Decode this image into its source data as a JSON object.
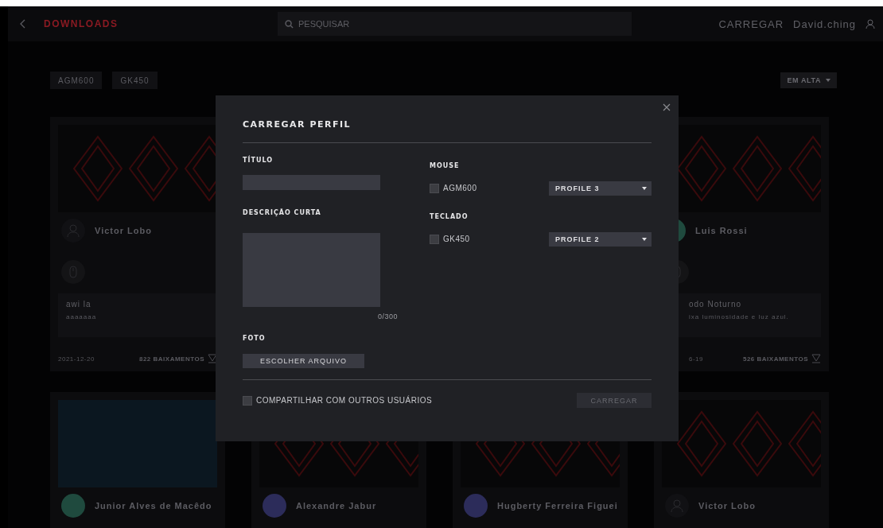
{
  "topbar": {
    "title": "DOWNLOADS",
    "search": {
      "placeholder": "PESQUISAR"
    },
    "upload_link": "CARREGAR",
    "user": "David.ching"
  },
  "filters": [
    {
      "label": "AGM600"
    },
    {
      "label": "GK450"
    }
  ],
  "sort": {
    "label": "EM ALTA"
  },
  "cards": [
    {
      "kind": "pattern",
      "avatar": {
        "kind": "silhouette"
      },
      "author": "Victor Lobo",
      "title": "awi la",
      "description": "aaaaaaa",
      "date": "2021-12-20",
      "downloads": "822 BAIXAMENTOS"
    },
    {
      "kind": "pattern",
      "avatar": {
        "kind": "photo"
      },
      "author": "Luis Rossi",
      "title": "odo Noturno",
      "description": "ixa luminosidade e luz azul.",
      "date": "6-19",
      "downloads": "526 BAIXAMENTOS"
    },
    {
      "kind": "photo",
      "avatar": {
        "kind": "photo"
      },
      "author": "Junior Alves de Macêdo"
    },
    {
      "kind": "pattern",
      "avatar": {
        "kind": "generic"
      },
      "author": "Alexandre Jabur"
    },
    {
      "kind": "pattern",
      "avatar": {
        "kind": "generic"
      },
      "author": "Hugberty Ferreira Figuei"
    },
    {
      "kind": "pattern",
      "avatar": {
        "kind": "silhouette"
      },
      "author": "Victor Lobo"
    }
  ],
  "modal": {
    "title": "CARREGAR PERFIL",
    "title_field": {
      "label": "TÍTULO"
    },
    "description_field": {
      "label": "DESCRIÇÃO CURTA",
      "counter": "0/300"
    },
    "photo": {
      "label": "FOTO",
      "button": "ESCOLHER ARQUIVO"
    },
    "devices": [
      {
        "category": "MOUSE",
        "name": "AGM600",
        "checked": false,
        "profile": "PROFILE 3"
      },
      {
        "category": "TECLADO",
        "name": "GK450",
        "checked": false,
        "profile": "PROFILE 2"
      }
    ],
    "share": {
      "label": "COMPARTILHAR COM OUTROS USUÁRIOS",
      "checked": false
    },
    "submit": {
      "label": "CARREGAR",
      "disabled": true
    }
  }
}
